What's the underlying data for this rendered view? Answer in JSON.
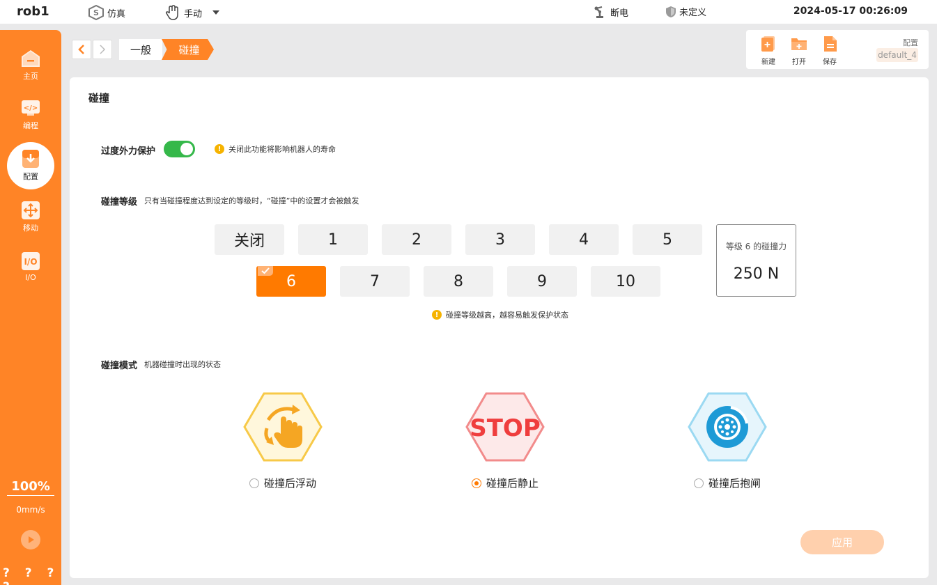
{
  "topbar": {
    "robot": "rob1",
    "mode": "仿真",
    "control": "手动",
    "power": "断电",
    "safety": "未定义",
    "datetime": "2024-05-17 00:26:09"
  },
  "sidebar": {
    "items": [
      {
        "label": "主页",
        "icon": "home-icon"
      },
      {
        "label": "编程",
        "icon": "code-icon"
      },
      {
        "label": "配置",
        "icon": "config-icon",
        "active": true
      },
      {
        "label": "移动",
        "icon": "move-icon"
      },
      {
        "label": "I/O",
        "icon": "io-icon"
      }
    ],
    "speed_percent": "100%",
    "speed_value": "0mm/s",
    "footer": "? ? ? ?"
  },
  "breadcrumb": {
    "items": [
      "一般",
      "碰撞"
    ]
  },
  "file_toolbar": {
    "new_label": "新建",
    "open_label": "打开",
    "save_label": "保存",
    "config_label": "配置",
    "config_value": "default_4"
  },
  "panel": {
    "title": "碰撞",
    "protection": {
      "label": "过度外力保护",
      "enabled": true,
      "warning": "关闭此功能将影响机器人的寿命"
    },
    "level": {
      "label": "碰撞等级",
      "description": "只有当碰撞程度达到设定的等级时，“碰撞”中的设置才会被触发",
      "options_row1": [
        "关闭",
        "1",
        "2",
        "3",
        "4",
        "5"
      ],
      "options_row2": [
        "6",
        "7",
        "8",
        "9",
        "10"
      ],
      "selected": "6",
      "force_label": "等级 6 的碰撞力",
      "force_value": "250 N",
      "hint": "碰撞等级越高，越容易触发保护状态"
    },
    "mode": {
      "label": "碰撞模式",
      "description": "机器碰撞时出现的状态",
      "options": [
        {
          "label": "碰撞后浮动",
          "icon": "float-icon",
          "color": "#f7c948"
        },
        {
          "label": "碰撞后静止",
          "icon": "stop-icon",
          "color": "#f05454",
          "icon_text": "STOP"
        },
        {
          "label": "碰撞后抱闸",
          "icon": "brake-icon",
          "color": "#1e9ad6"
        }
      ],
      "selected": "碰撞后静止"
    },
    "apply_label": "应用"
  },
  "colors": {
    "accent": "#ff8426",
    "selected": "#ff7a00",
    "toggle_on": "#35b84a"
  }
}
